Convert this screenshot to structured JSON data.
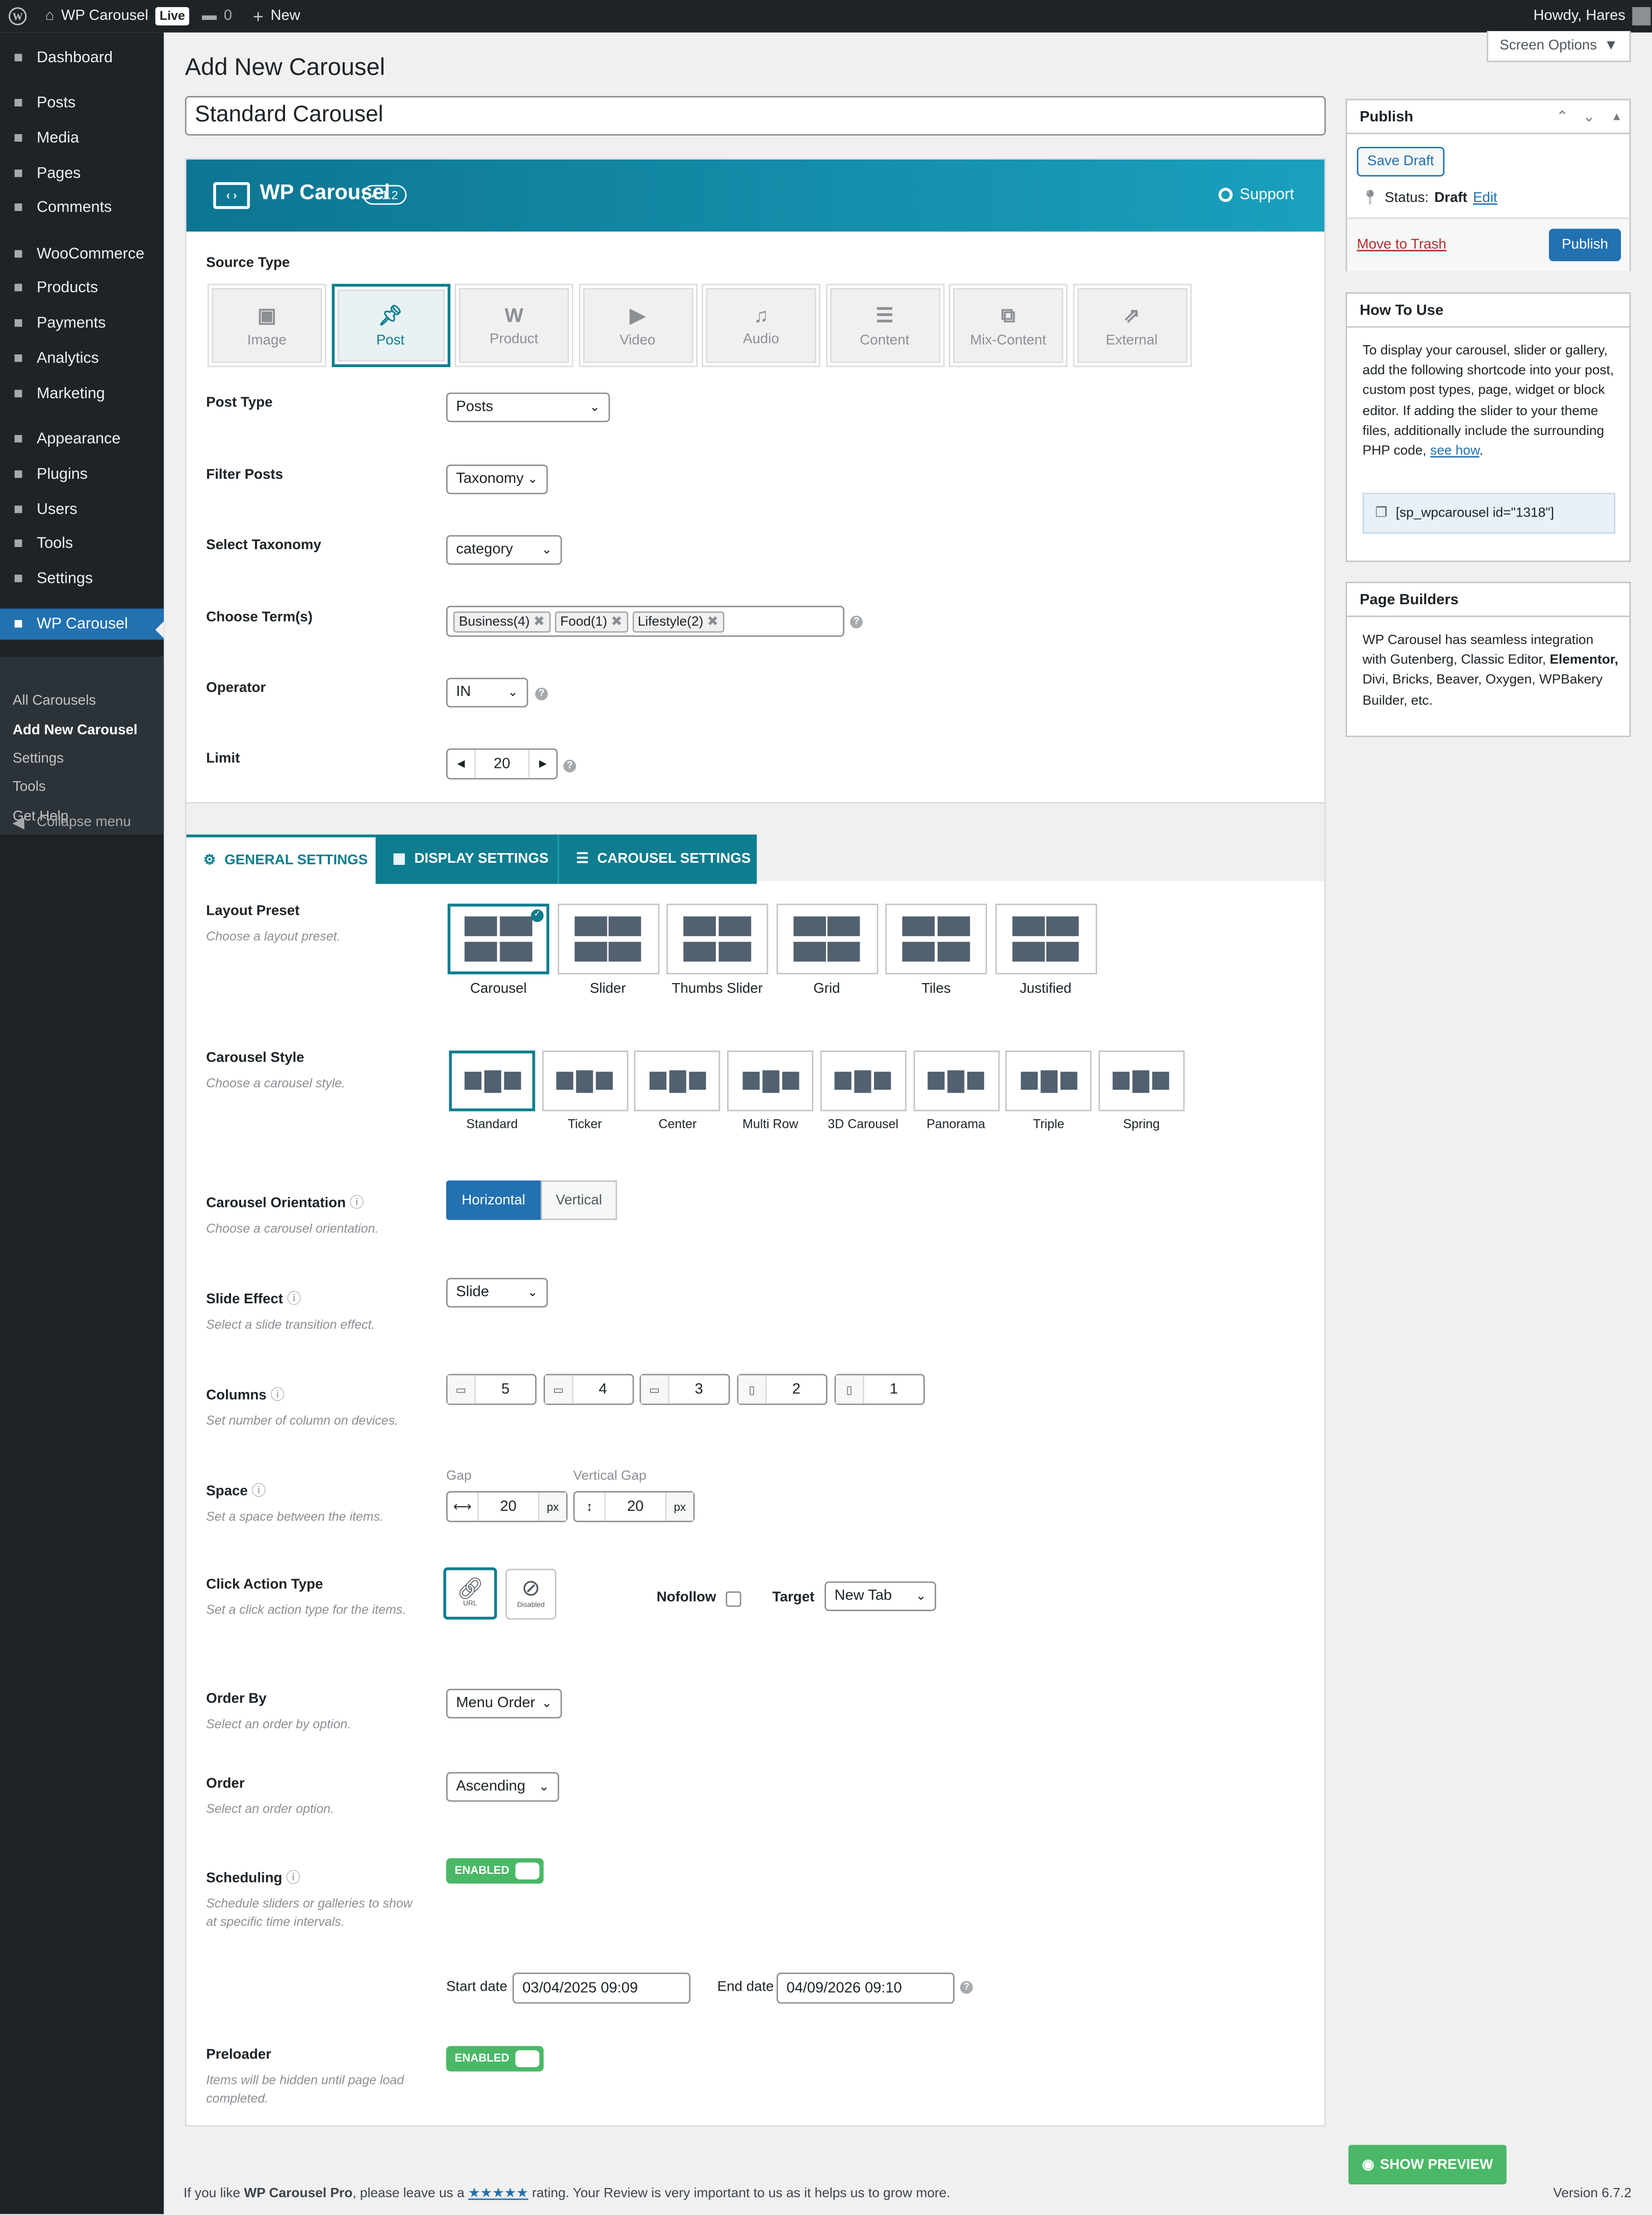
{
  "adminbar": {
    "site": "WP Carousel",
    "live": "Live",
    "comments": "0",
    "new": "New",
    "howdy": "Howdy, Hares"
  },
  "sidebar": {
    "items": [
      {
        "label": "Dashboard",
        "icon": "dashboard-icon"
      },
      {
        "label": "Posts",
        "icon": "pin-icon"
      },
      {
        "label": "Media",
        "icon": "media-icon"
      },
      {
        "label": "Pages",
        "icon": "page-icon"
      },
      {
        "label": "Comments",
        "icon": "comment-icon"
      },
      {
        "label": "WooCommerce",
        "icon": "woo-icon"
      },
      {
        "label": "Products",
        "icon": "archive-icon"
      },
      {
        "label": "Payments",
        "icon": "dollar-icon"
      },
      {
        "label": "Analytics",
        "icon": "chart-icon"
      },
      {
        "label": "Marketing",
        "icon": "megaphone-icon"
      },
      {
        "label": "Appearance",
        "icon": "brush-icon"
      },
      {
        "label": "Plugins",
        "icon": "plugin-icon"
      },
      {
        "label": "Users",
        "icon": "user-icon"
      },
      {
        "label": "Tools",
        "icon": "wrench-icon"
      },
      {
        "label": "Settings",
        "icon": "settings-icon"
      },
      {
        "label": "WP Carousel",
        "icon": "carousel-icon"
      }
    ],
    "submenu": [
      "All Carousels",
      "Add New Carousel",
      "Settings",
      "Tools",
      "Get Help"
    ],
    "collapse": "Collapse menu"
  },
  "page": {
    "title": "Add New Carousel",
    "screen_options": "Screen Options",
    "post_title": "Standard Carousel"
  },
  "banner": {
    "brand": "WP Carousel",
    "version": "4.1.2",
    "support": "Support"
  },
  "source": {
    "label": "Source Type",
    "types": [
      "Image",
      "Post",
      "Product",
      "Video",
      "Audio",
      "Content",
      "Mix-Content",
      "External"
    ],
    "selected": "Post"
  },
  "fields": {
    "post_type": {
      "label": "Post Type",
      "value": "Posts"
    },
    "filter_posts": {
      "label": "Filter Posts",
      "value": "Taxonomy"
    },
    "select_taxonomy": {
      "label": "Select Taxonomy",
      "value": "category"
    },
    "choose_terms": {
      "label": "Choose Term(s)",
      "terms": [
        "Business(4)",
        "Food(1)",
        "Lifestyle(2)"
      ]
    },
    "operator": {
      "label": "Operator",
      "value": "IN"
    },
    "limit": {
      "label": "Limit",
      "value": "20"
    }
  },
  "tabs": [
    "GENERAL SETTINGS",
    "DISPLAY SETTINGS",
    "CAROUSEL SETTINGS"
  ],
  "layout_preset": {
    "label": "Layout Preset",
    "desc": "Choose a layout preset.",
    "options": [
      "Carousel",
      "Slider",
      "Thumbs Slider",
      "Grid",
      "Tiles",
      "Justified"
    ]
  },
  "carousel_style": {
    "label": "Carousel Style",
    "desc": "Choose a carousel style.",
    "options": [
      "Standard",
      "Ticker",
      "Center",
      "Multi Row",
      "3D Carousel",
      "Panorama",
      "Triple",
      "Spring"
    ]
  },
  "orientation": {
    "label": "Carousel Orientation",
    "desc": "Choose a carousel orientation.",
    "options": [
      "Horizontal",
      "Vertical"
    ]
  },
  "slide_effect": {
    "label": "Slide Effect",
    "desc": "Select a slide transition effect.",
    "value": "Slide"
  },
  "columns": {
    "label": "Columns",
    "desc": "Set number of column on devices.",
    "values": [
      "5",
      "4",
      "3",
      "2",
      "1"
    ]
  },
  "space": {
    "label": "Space",
    "desc": "Set a space between the items.",
    "gap_label": "Gap",
    "gap": "20",
    "vgap_label": "Vertical Gap",
    "vgap": "20",
    "unit": "px"
  },
  "click_action": {
    "label": "Click Action Type",
    "desc": "Set a click action type for the items.",
    "url": "URL",
    "disabled": "Disabled",
    "nofollow": "Nofollow",
    "target_label": "Target",
    "target": "New Tab"
  },
  "order_by": {
    "label": "Order By",
    "desc": "Select an order by option.",
    "value": "Menu Order"
  },
  "order": {
    "label": "Order",
    "desc": "Select an order option.",
    "value": "Ascending"
  },
  "scheduling": {
    "label": "Scheduling",
    "desc": "Schedule sliders or galleries to show at specific time intervals.",
    "toggle": "ENABLED",
    "start_label": "Start date",
    "start": "03/04/2025 09:09",
    "end_label": "End date",
    "end": "04/09/2026 09:10"
  },
  "preloader": {
    "label": "Preloader",
    "desc": "Items will be hidden until page load completed.",
    "toggle": "ENABLED"
  },
  "publish": {
    "title": "Publish",
    "save_draft": "Save Draft",
    "status_label": "Status:",
    "status": "Draft",
    "edit": "Edit",
    "trash": "Move to Trash",
    "publish": "Publish"
  },
  "howto": {
    "title": "How To Use",
    "text": "To display your carousel, slider or gallery, add the following shortcode into your post, custom post types, page, widget or block editor. If adding the slider to your theme files, additionally include the surrounding PHP code,",
    "link": "see how",
    "shortcode": "[sp_wpcarousel id=\"1318\"]"
  },
  "builders": {
    "title": "Page Builders",
    "text1": "WP Carousel has seamless integration with Gutenberg, Classic Editor,",
    "bold": "Elementor,",
    "text2": "Divi, Bricks, Beaver, Oxygen, WPBakery Builder, etc."
  },
  "preview": "SHOW PREVIEW",
  "footer": {
    "pre": "If you like",
    "brand": "WP Carousel Pro",
    "mid": ", please leave us a",
    "stars": "★★★★★",
    "post": "rating. Your Review is very important to us as it helps us to grow more.",
    "version": "Version 6.7.2"
  },
  "colors": {
    "accent": "#0e7d8f",
    "wp_blue": "#2271b1",
    "enabled": "#4ab866"
  }
}
